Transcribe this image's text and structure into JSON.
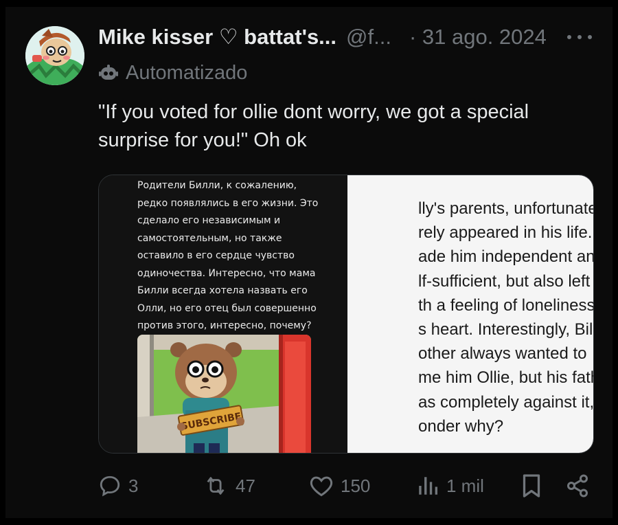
{
  "tweet": {
    "display_name": "Mike kisser ♡ battat's...",
    "handle": "@f...",
    "date": "· 31 ago. 2024",
    "label": "Automatizado",
    "text": "\"If you voted for ollie dont worry, we got a special surprise for you!\" Oh ok"
  },
  "media": {
    "russian_lines": [
      "Родители Билли, к сожалению,",
      "редко появлялись в его жизни. Это",
      "сделало его независимым и",
      "самостоятельным, но также",
      "оставило в его сердце чувство",
      "одиночества. Интересно, что мама",
      "Билли всегда хотела назвать его",
      "Олли, но его отец был совершенно",
      "против этого, интересно, почему?"
    ],
    "sign_text": "SUBSCRIBE",
    "english_lines": [
      "lly's parents, unfortunately,",
      "rely appeared in his life. This",
      "ade him independent and",
      "lf-sufficient, but also left him",
      "th a feeling of loneliness in",
      "s heart. Interestingly, Billy's",
      "other always wanted to",
      "me him Ollie, but his father",
      "as completely against it, I",
      "onder why?"
    ]
  },
  "actions": {
    "replies": "3",
    "reposts": "47",
    "likes": "150",
    "views": "1 mil"
  },
  "icons": {
    "reply": "reply-icon",
    "repost": "repost-icon",
    "like": "heart-icon",
    "views": "views-icon",
    "bookmark": "bookmark-icon",
    "share": "share-icon",
    "more": "more-icon",
    "bot": "bot-icon"
  },
  "colors": {
    "background": "#000000",
    "text_primary": "#e7e9ea",
    "text_secondary": "#71767b"
  }
}
